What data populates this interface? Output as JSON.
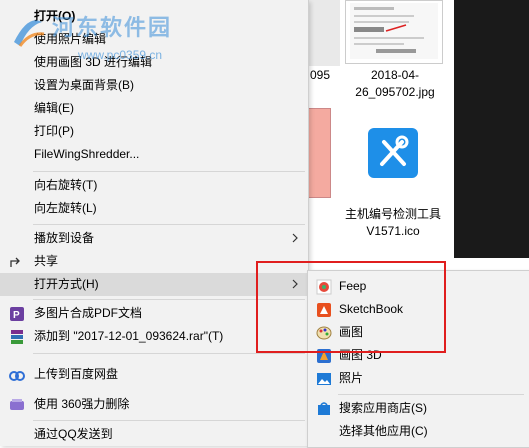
{
  "watermark": {
    "site_name": "河东软件园",
    "url": "www.pc0359.cn"
  },
  "explorer": {
    "files": [
      {
        "name": "095"
      },
      {
        "name": "2018-04-26_095702.jpg"
      },
      {
        "name": "主机编号检测工具V1571.ico"
      }
    ]
  },
  "context_menu": {
    "open": "打开(O)",
    "edit_photos": "使用照片编辑",
    "edit_paint3d": "使用画图 3D 进行编辑",
    "set_wallpaper": "设置为桌面背景(B)",
    "edit": "编辑(E)",
    "print": "打印(P)",
    "filewing": "FileWingShredder...",
    "rotate_right": "向右旋转(T)",
    "rotate_left": "向左旋转(L)",
    "cast": "播放到设备",
    "share": "共享",
    "open_with": "打开方式(H)",
    "merge_pdf": "多图片合成PDF文档",
    "add_to_rar": "添加到 \"2017-12-01_093624.rar\"(T)",
    "upload_baidu": "上传到百度网盘",
    "delete_360": "使用 360强力删除",
    "send_qq": "通过QQ发送到"
  },
  "submenu": {
    "feep": "Feep",
    "sketchbook": "SketchBook",
    "paint": "画图",
    "paint3d": "画图 3D",
    "photos": "照片",
    "search_store": "搜索应用商店(S)",
    "choose_other": "选择其他应用(C)"
  },
  "colors": {
    "highlight": "#e01e1e",
    "menu_bg": "#f2f2f2",
    "hover": "#dadada"
  }
}
